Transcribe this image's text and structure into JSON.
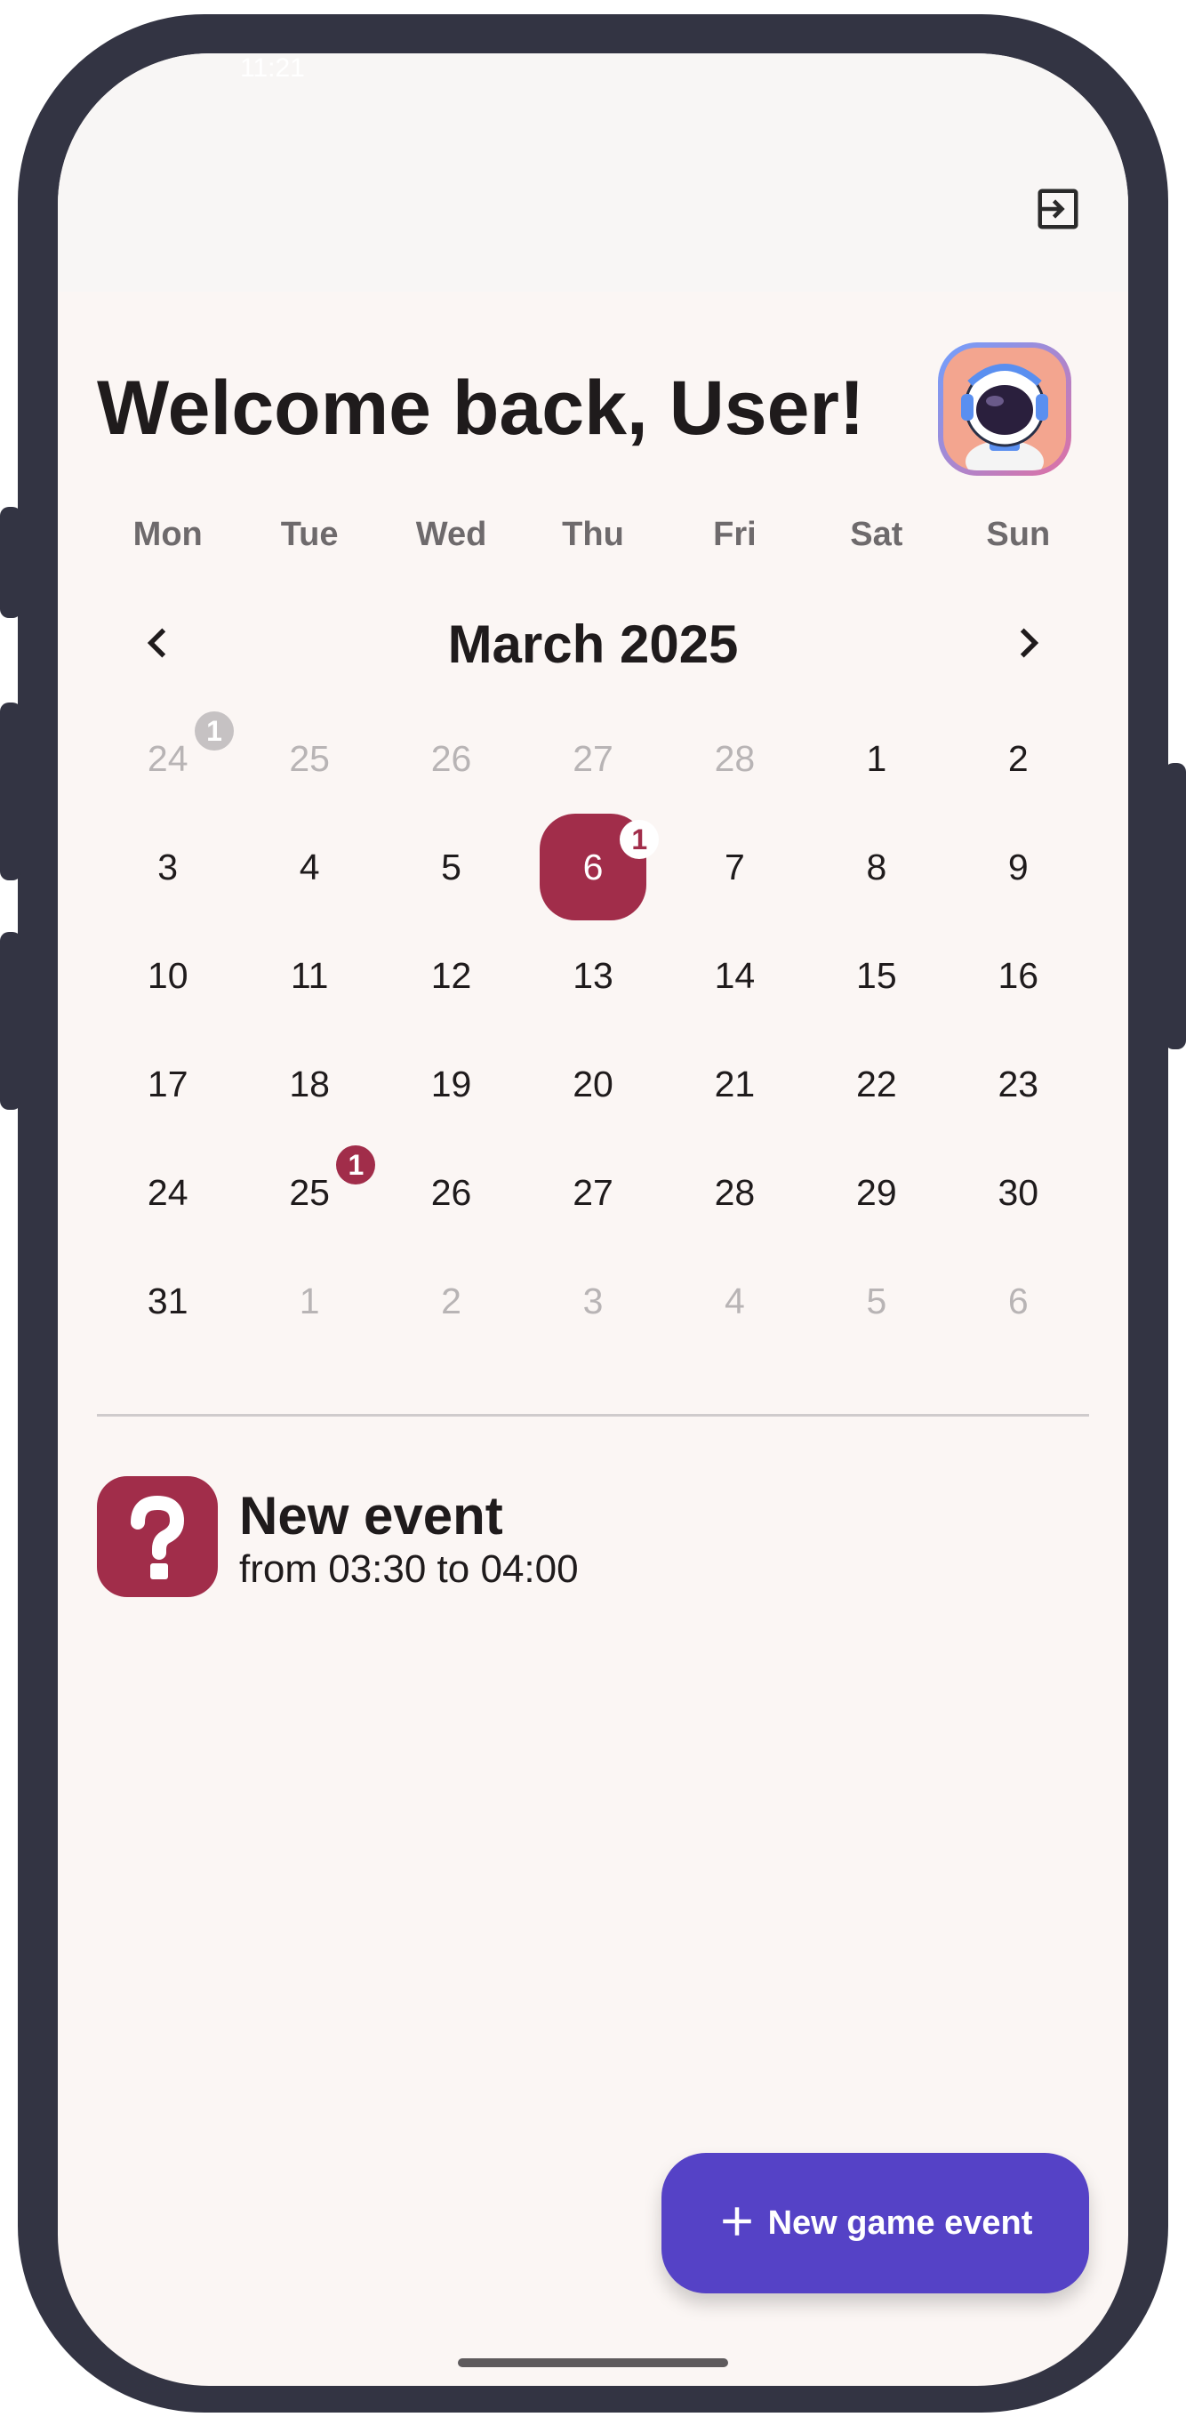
{
  "status": {
    "time": "11:21"
  },
  "header": {
    "welcome": "Welcome back, User!"
  },
  "calendar": {
    "weekdays": [
      "Mon",
      "Tue",
      "Wed",
      "Thu",
      "Fri",
      "Sat",
      "Sun"
    ],
    "month_label": "March 2025",
    "weeks": [
      [
        "24",
        "25",
        "26",
        "27",
        "28",
        "1",
        "2"
      ],
      [
        "3",
        "4",
        "5",
        "6",
        "7",
        "8",
        "9"
      ],
      [
        "10",
        "11",
        "12",
        "13",
        "14",
        "15",
        "16"
      ],
      [
        "17",
        "18",
        "19",
        "20",
        "21",
        "22",
        "23"
      ],
      [
        "24",
        "25",
        "26",
        "27",
        "28",
        "29",
        "30"
      ],
      [
        "31",
        "1",
        "2",
        "3",
        "4",
        "5",
        "6"
      ]
    ],
    "muted": [
      [
        0,
        0
      ],
      [
        0,
        1
      ],
      [
        0,
        2
      ],
      [
        0,
        3
      ],
      [
        0,
        4
      ],
      [
        5,
        1
      ],
      [
        5,
        2
      ],
      [
        5,
        3
      ],
      [
        5,
        4
      ],
      [
        5,
        5
      ],
      [
        5,
        6
      ]
    ],
    "today": [
      1,
      3
    ],
    "badges": [
      {
        "cell": [
          0,
          0
        ],
        "count": "1",
        "style": "muted"
      },
      {
        "cell": [
          1,
          3
        ],
        "count": "1",
        "style": "light"
      },
      {
        "cell": [
          4,
          1
        ],
        "count": "1",
        "style": "accent"
      }
    ]
  },
  "events": [
    {
      "title": "New event",
      "time": "from 03:30 to 04:00",
      "icon": "question-mark-icon"
    }
  ],
  "fab": {
    "label": "New game event",
    "icon": "plus-icon"
  },
  "colors": {
    "accent": "#a12d4a",
    "primary": "#5542c6",
    "background": "#fbf6f4"
  }
}
